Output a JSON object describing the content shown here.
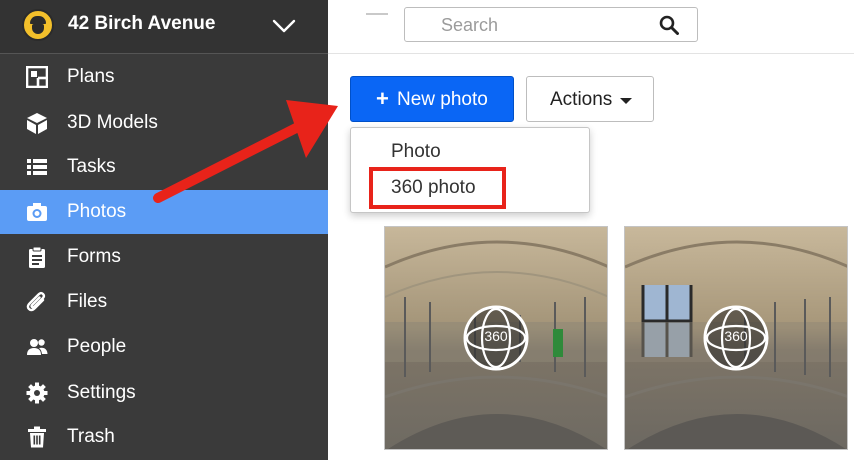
{
  "project": {
    "name": "42 Birch Avenue"
  },
  "sidebar": {
    "items": [
      {
        "label": "Plans",
        "icon": "plans-icon",
        "active": false
      },
      {
        "label": "3D Models",
        "icon": "cube-icon",
        "active": false
      },
      {
        "label": "Tasks",
        "icon": "list-icon",
        "active": false
      },
      {
        "label": "Photos",
        "icon": "camera-icon",
        "active": true
      },
      {
        "label": "Forms",
        "icon": "clipboard-icon",
        "active": false
      },
      {
        "label": "Files",
        "icon": "paperclip-icon",
        "active": false
      },
      {
        "label": "People",
        "icon": "people-icon",
        "active": false
      },
      {
        "label": "Settings",
        "icon": "gear-icon",
        "active": false
      },
      {
        "label": "Trash",
        "icon": "trash-icon",
        "active": false
      }
    ]
  },
  "search": {
    "placeholder": "Search"
  },
  "toolbar": {
    "new_photo_plus": "+",
    "new_photo_label": "New photo",
    "actions_label": "Actions"
  },
  "dropdown": {
    "items": [
      "Photo",
      "360 photo"
    ]
  },
  "photos": [
    {
      "badge": "360"
    },
    {
      "badge": "360"
    }
  ],
  "colors": {
    "sidebar_bg": "#3a3a3a",
    "active_item": "#5b9cf5",
    "primary_button": "#0a66f5",
    "callout_red": "#e8231a"
  }
}
